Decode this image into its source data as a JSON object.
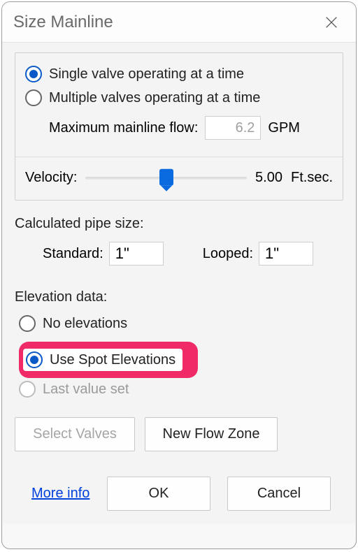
{
  "title": "Size Mainline",
  "valveMode": {
    "single": "Single valve operating at a time",
    "multiple": "Multiple valves operating at a time",
    "selected": "single"
  },
  "flow": {
    "label": "Maximum mainline flow:",
    "value": "6.2",
    "units": "GPM"
  },
  "velocity": {
    "label": "Velocity:",
    "value": "5.00",
    "units": "Ft.sec."
  },
  "pipe": {
    "heading": "Calculated pipe size:",
    "standardLabel": "Standard:",
    "standardValue": "1\"",
    "loopedLabel": "Looped:",
    "loopedValue": "1\""
  },
  "elevation": {
    "heading": "Elevation data:",
    "none": "No elevations",
    "spot": "Use Spot Elevations",
    "last": "Last value set",
    "selected": "spot",
    "highlight": "spot"
  },
  "buttons": {
    "selectValves": "Select Valves",
    "newFlowZone": "New Flow Zone",
    "ok": "OK",
    "cancel": "Cancel",
    "moreInfo": "More info"
  }
}
